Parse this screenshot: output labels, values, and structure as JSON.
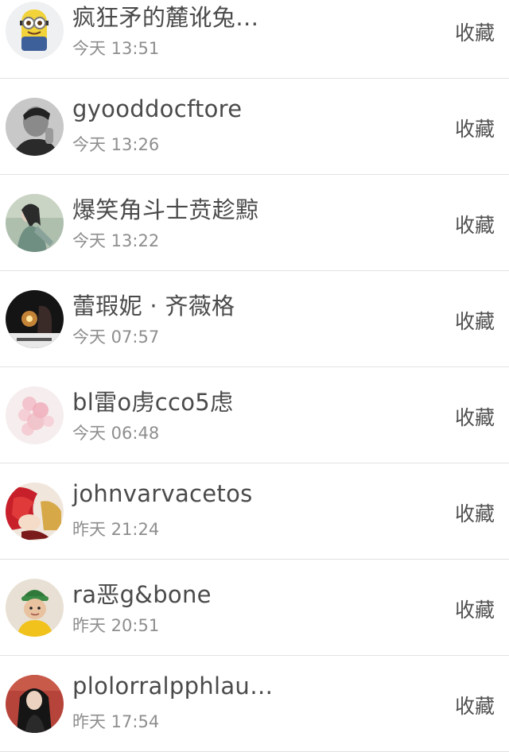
{
  "collect_label": "收藏",
  "users": [
    {
      "name": "疯狂矛的麓讹兔…",
      "time": "今天 13:51",
      "avatar": "minion-avatar"
    },
    {
      "name": "gyooddocftore",
      "time": "今天 13:26",
      "avatar": "man-bw-avatar"
    },
    {
      "name": "爆笑角斗士贲趁黥",
      "time": "今天 13:22",
      "avatar": "woman-green-avatar"
    },
    {
      "name": "蕾瑕妮 · 齐薇格",
      "time": "今天 07:57",
      "avatar": "night-photo-avatar"
    },
    {
      "name": "bl雷o虏cco5虑",
      "time": "今天 06:48",
      "avatar": "pink-blossom-avatar"
    },
    {
      "name": "johnvarvacetos",
      "time": "昨天 21:24",
      "avatar": "anime-red-hair-avatar"
    },
    {
      "name": "ra恶g&bone",
      "time": "昨天 20:51",
      "avatar": "child-green-hat-avatar"
    },
    {
      "name": "plolorralpphlau…",
      "time": "昨天 17:54",
      "avatar": "girl-portrait-avatar"
    }
  ]
}
